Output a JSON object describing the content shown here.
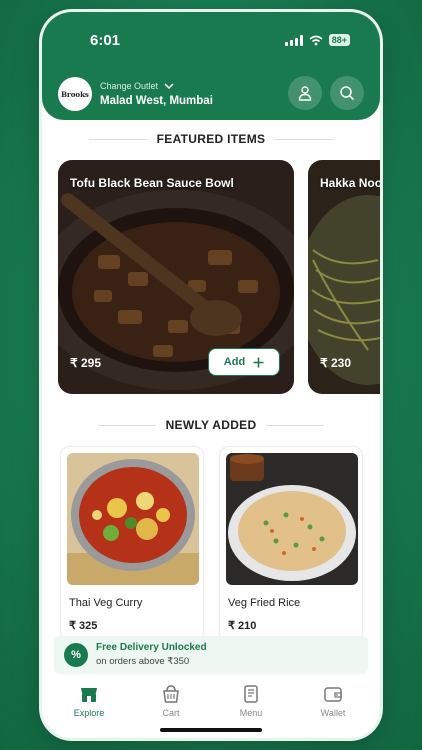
{
  "status": {
    "time": "6:01",
    "battery": "88+"
  },
  "header": {
    "logo_text": "Brooks",
    "change_outlet_label": "Change Outlet",
    "outlet_name": "Malad West, Mumbai"
  },
  "featured": {
    "title": "FEATURED ITEMS",
    "items": [
      {
        "name": "Tofu Black Bean Sauce Bowl",
        "price": "₹ 295",
        "add_label": "Add"
      },
      {
        "name": "Hakka Noodles",
        "price": "₹ 230"
      }
    ]
  },
  "newly_added": {
    "title": "NEWLY ADDED",
    "items": [
      {
        "name": "Thai Veg Curry",
        "price": "₹ 325"
      },
      {
        "name": "Veg Fried Rice",
        "price": "₹ 210"
      }
    ]
  },
  "promo": {
    "icon_text": "%",
    "title": "Free Delivery Unlocked",
    "subtitle": "on orders above ₹350"
  },
  "tabs": [
    {
      "label": "Explore",
      "icon": "store-icon",
      "active": true
    },
    {
      "label": "Cart",
      "icon": "basket-icon",
      "active": false
    },
    {
      "label": "Menu",
      "icon": "menu-book-icon",
      "active": false
    },
    {
      "label": "Wallet",
      "icon": "wallet-icon",
      "active": false
    }
  ],
  "colors": {
    "brand": "#1a7a4f",
    "background": "#16744c"
  }
}
